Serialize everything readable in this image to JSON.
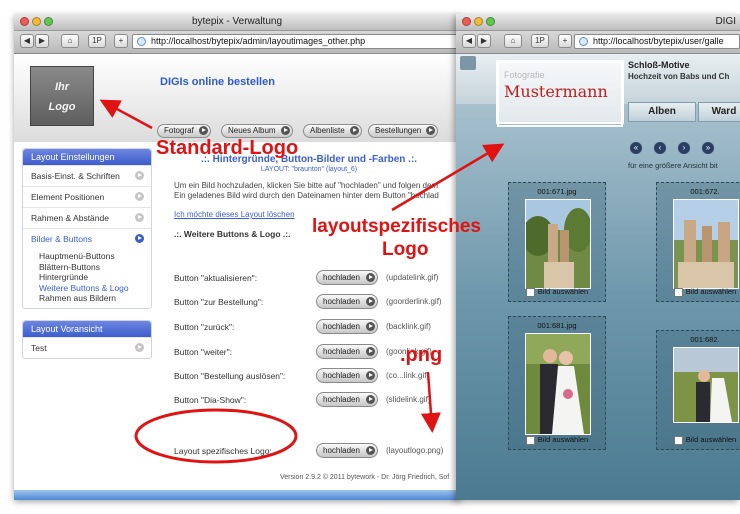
{
  "left_window": {
    "title": "bytepix - Verwaltung",
    "url": "http://localhost/bytepix/admin/layoutimages_other.php",
    "toolbar_buttons": [
      "◀",
      "▶",
      "⌂",
      "1P",
      "+"
    ],
    "logo_lines": [
      "Ihr",
      "Logo"
    ],
    "brand": "DIGIs online bestellen",
    "nav": [
      "Fotograf",
      "Neues Album",
      "Albenliste",
      "Bestellungen"
    ],
    "settings_panel": {
      "title": "Layout Einstellungen",
      "items": [
        "Basis-Einst. & Schriften",
        "Element Positionen",
        "Rahmen & Abstände",
        "Bilder & Buttons"
      ],
      "sub_items": [
        "Hauptmenü-Buttons",
        "Blättern-Buttons",
        "Hintergründe",
        "Weitere Buttons & Logo",
        "Rahmen aus Bildern"
      ]
    },
    "preview_panel": {
      "title": "Layout Voransicht",
      "items": [
        "Test"
      ]
    },
    "main": {
      "heading": ".:. Hintergründe, Button-Bilder und -Farben .:.",
      "subheading": "LAYOUT: \"braunton\" (layout_6)",
      "text1": "Um ein Bild hochzuladen, klicken Sie bitte auf \"hochladen\" und folgen dem",
      "text2": "Ein geladenes Bild wird durch den Dateinamen hinter dem Button \"hochlad",
      "delete_link": "Ich möchte dieses Layout löschen",
      "section": ".:. Weitere Buttons & Logo .:."
    },
    "button_rows": [
      {
        "label": "Button \"aktualisieren\":",
        "button": "hochladen",
        "file": "(updatelink.gif)"
      },
      {
        "label": "Button \"zur Bestellung\":",
        "button": "hochladen",
        "file": "(goorderlink.gif)"
      },
      {
        "label": "Button \"zurück\":",
        "button": "hochladen",
        "file": "(backlink.gif)"
      },
      {
        "label": "Button \"weiter\":",
        "button": "hochladen",
        "file": "(goonlink.gif)"
      },
      {
        "label": "Button \"Bestellung auslösen\":",
        "button": "hochladen",
        "file": "(co...link.gif)"
      },
      {
        "label": "Button \"Dia-Show\":",
        "button": "hochladen",
        "file": "(slidelink.gif)"
      },
      {
        "label": "Layout spezifisches Logo:",
        "button": "hochladen",
        "file": "(layoutlogo.png)"
      }
    ],
    "version": "Version 2.9.2 © 2011 bytework - Dr. Jörg Friedrich, Sof"
  },
  "right_window": {
    "title": "DIGI",
    "url": "http://localhost/bytepix/user/galle",
    "toolbar_buttons": [
      "◀",
      "▶",
      "⌂",
      "1P",
      "+"
    ],
    "logo_small": "Fotografie",
    "logo_big": "Mustermann",
    "title_text": "Schloß-Motive",
    "subtitle": "Hochzeit von Babs und Ch",
    "tabs": [
      "Alben",
      "Ward"
    ],
    "pager": [
      "«",
      "‹",
      "›",
      "»"
    ],
    "hint": "für eine größere Ansicht bit",
    "thumbs": [
      {
        "name": "001:671.jpg",
        "select": "Bild auswählen"
      },
      {
        "name": "001:672.",
        "select": "Bild auswählen"
      },
      {
        "name": "001:681.jpg",
        "select": "Bild auswählen"
      },
      {
        "name": "001:682.",
        "select": "Bild auswählen"
      }
    ]
  },
  "annotations": {
    "standard_logo": "Standard-Logo",
    "layout_logo_1": "layoutspezifisches",
    "layout_logo_2": "Logo",
    "png": ".png"
  },
  "colors": {
    "annotation_red": "#e01212",
    "accent_blue": "#3a5fcd",
    "gallery_teal": "#6d97ab"
  }
}
